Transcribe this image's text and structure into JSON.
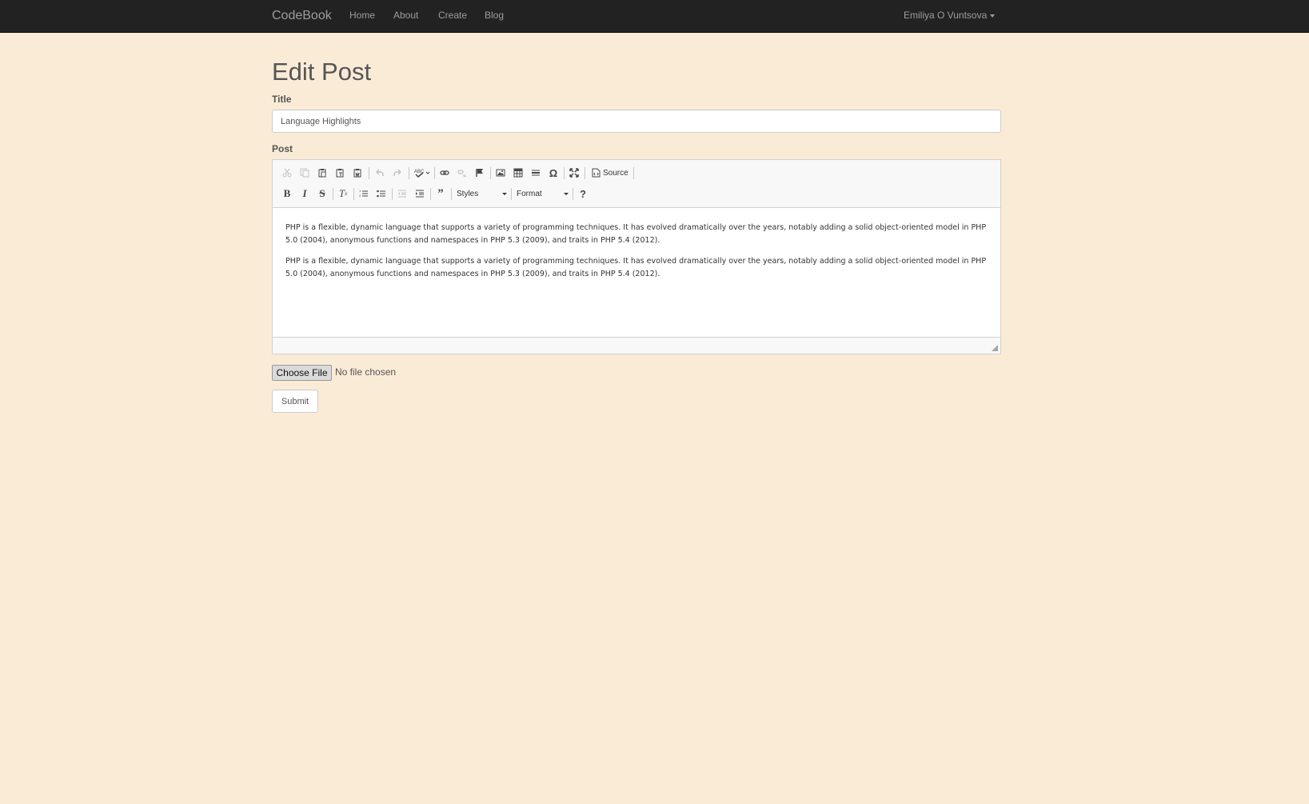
{
  "navbar": {
    "brand": "CodeBook",
    "links": [
      "Home",
      "About",
      "Create",
      "Blog"
    ],
    "user": "Emiliya O Vuntsova"
  },
  "page": {
    "title": "Edit Post"
  },
  "form": {
    "title_label": "Title",
    "title_value": "Language Highlights",
    "post_label": "Post",
    "file_button": "Choose File",
    "file_status": "No file chosen",
    "submit_label": "Submit"
  },
  "editor": {
    "toolbar_row1": [
      "cut-icon",
      "copy-icon",
      "paste-icon",
      "paste-text-icon",
      "paste-word-icon",
      "undo-icon",
      "redo-icon",
      "spellcheck-icon",
      "link-icon",
      "unlink-icon",
      "anchor-icon",
      "image-icon",
      "table-icon",
      "horizontal-rule-icon",
      "special-char-icon",
      "maximize-icon"
    ],
    "source_label": "Source",
    "toolbar_row2": [
      "bold-icon",
      "italic-icon",
      "strike-icon",
      "remove-format-icon",
      "numbered-list-icon",
      "bulleted-list-icon",
      "outdent-icon",
      "indent-icon",
      "blockquote-icon"
    ],
    "styles_label": "Styles",
    "format_label": "Format",
    "help_label": "?",
    "paragraphs": [
      "PHP is a flexible, dynamic language that supports a variety of programming techniques. It has evolved dramatically over the years, notably adding a solid object-oriented model in PHP 5.0 (2004), anonymous functions and namespaces in PHP 5.3 (2009), and traits in PHP 5.4 (2012).",
      "PHP is a flexible, dynamic language that supports a variety of programming techniques. It has evolved dramatically over the years, notably adding a solid object-oriented model in PHP 5.0 (2004), anonymous functions and namespaces in PHP 5.3 (2009), and traits in PHP 5.4 (2012)."
    ]
  },
  "colors": {
    "background": "#faebd7",
    "navbar": "#222222",
    "nav_text": "#9d9d9d"
  }
}
